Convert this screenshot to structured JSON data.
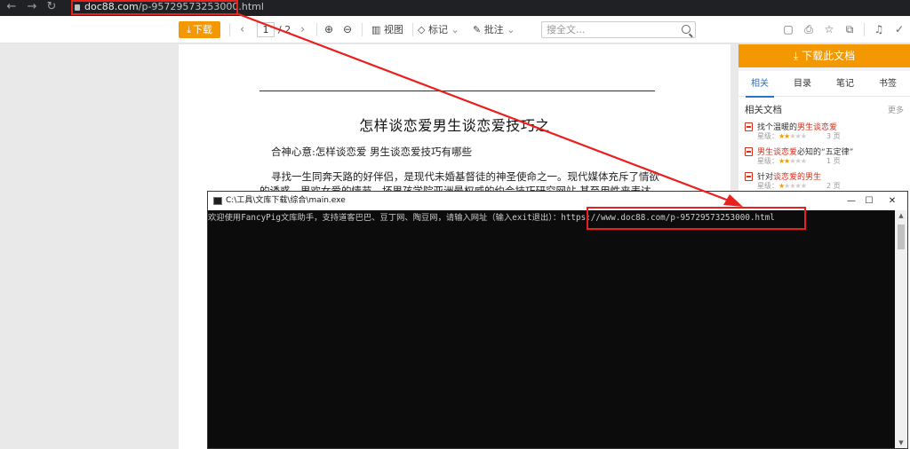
{
  "browser": {
    "url_host": "doc88.com",
    "url_path": "/p-95729573253000.html"
  },
  "toolbar": {
    "download_label": "下载",
    "current_page": "1",
    "total_pages": "/ 2",
    "view_label": "视图",
    "mark_label": "标记",
    "annotate_label": "批注",
    "search_placeholder": "搜全文..."
  },
  "document": {
    "title": "怎样谈恋爱男生谈恋爱技巧之",
    "para1": "合神心意:怎样谈恋爱 男生谈恋爱技巧有哪些",
    "para2": "寻找一生同奔天路的好伴侣，是现代未婚基督徒的神圣使命之一。现代媒体充斥了情欲的诱惑，男欢女爱的情节。坏男孩学院亚洲最权威的约会技巧研究网站 甚至用性来表达对"
  },
  "sidebar": {
    "download_label": "下载此文档",
    "tabs": [
      "相关",
      "目录",
      "笔记",
      "书签"
    ],
    "related_heading": "相关文档",
    "more_label": "更多",
    "related": [
      {
        "prefix": "找个温暖的",
        "highlight": "男生谈恋爱",
        "suffix": "",
        "rating_label": "星级：",
        "stars": 2,
        "pages": "3 页"
      },
      {
        "prefix": "",
        "highlight": "男生谈恋爱",
        "suffix": "必知的“五定律”",
        "rating_label": "星级：",
        "stars": 2,
        "pages": "1 页"
      },
      {
        "prefix": "针对",
        "highlight": "谈恋爱的男生",
        "suffix": "",
        "rating_label": "星级：",
        "stars": 1,
        "pages": "2 页"
      }
    ]
  },
  "console": {
    "title": "C:\\工具\\文库下载\\综合\\main.exe",
    "prompt": "欢迎使用FancyPig文库助手，支持道客巴巴、豆丁网、陶豆网，请输入网址（输入exit退出）：",
    "input": "https://www.doc88.com/p-95729573253000.html"
  },
  "annotation": {
    "color": "#e8211f"
  }
}
